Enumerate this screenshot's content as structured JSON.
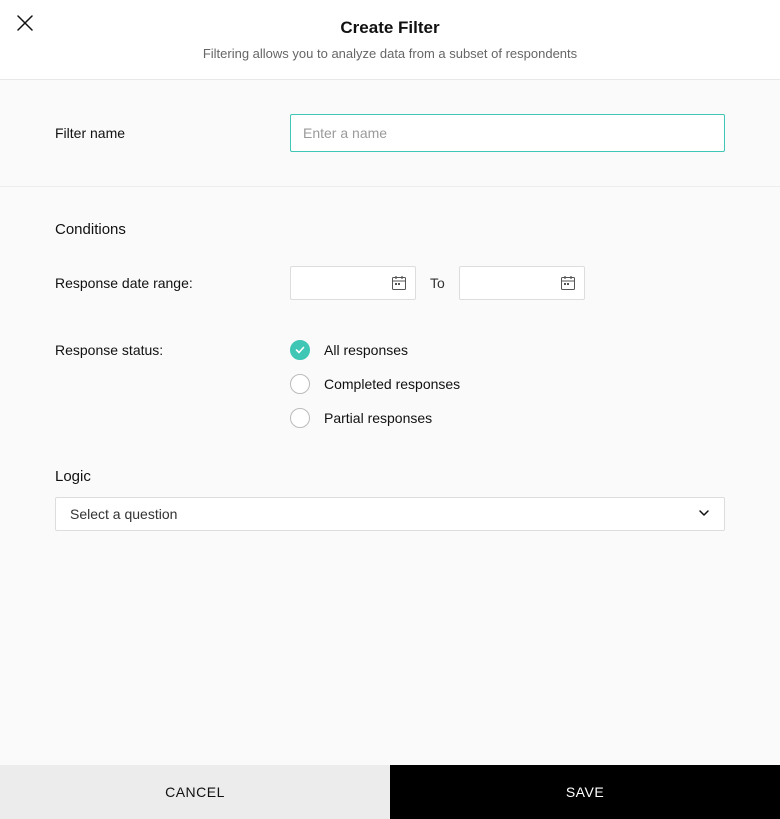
{
  "header": {
    "title": "Create Filter",
    "subtitle": "Filtering allows you to analyze data from a subset of respondents"
  },
  "filterName": {
    "label": "Filter name",
    "placeholder": "Enter a name",
    "value": ""
  },
  "conditions": {
    "heading": "Conditions",
    "dateRange": {
      "label": "Response date range:",
      "toLabel": "To",
      "from": "",
      "to": ""
    },
    "status": {
      "label": "Response status:",
      "options": [
        {
          "label": "All responses",
          "checked": true
        },
        {
          "label": "Completed responses",
          "checked": false
        },
        {
          "label": "Partial responses",
          "checked": false
        }
      ]
    }
  },
  "logic": {
    "heading": "Logic",
    "selectPlaceholder": "Select a question"
  },
  "footer": {
    "cancel": "CANCEL",
    "save": "SAVE"
  },
  "colors": {
    "accent": "#3fc6b5"
  }
}
